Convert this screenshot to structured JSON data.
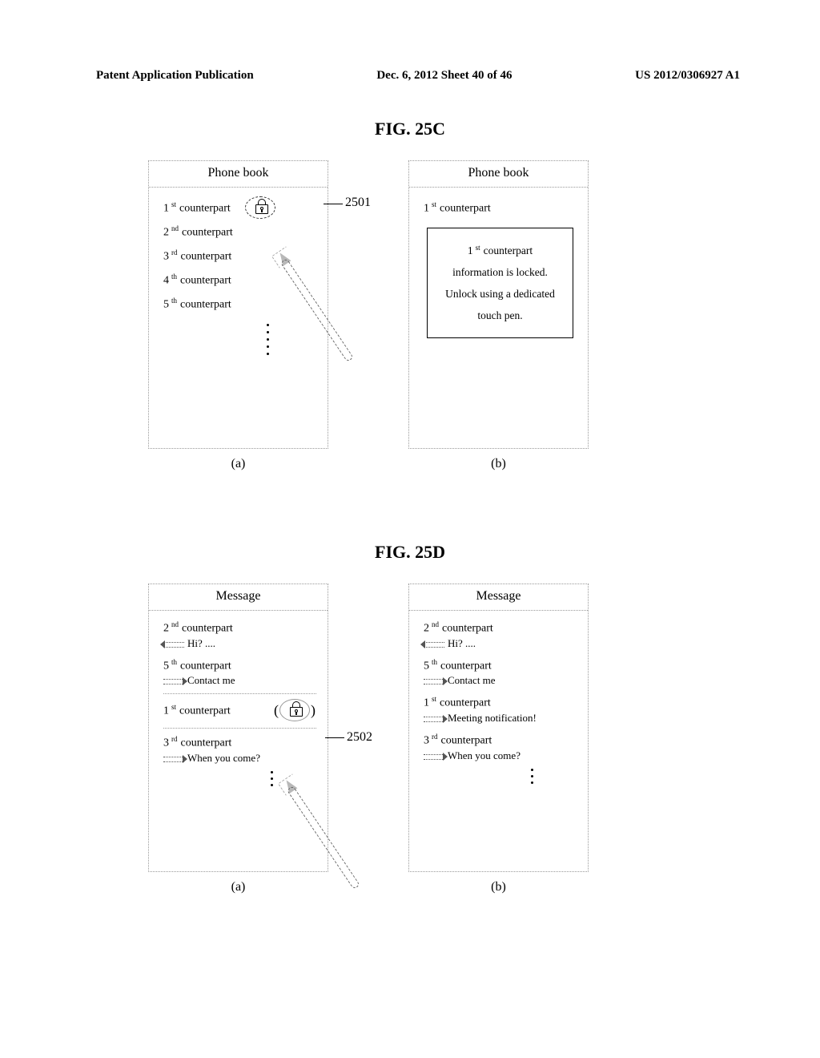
{
  "header": {
    "left": "Patent Application Publication",
    "center": "Dec. 6, 2012  Sheet 40 of 46",
    "right": "US 2012/0306927 A1"
  },
  "figC": {
    "title": "FIG. 25C",
    "ref": "2501",
    "a": {
      "caption": "(a)",
      "header": "Phone book",
      "contacts": [
        {
          "ord": "1",
          "suffix": "st",
          "label": "counterpart",
          "locked": true
        },
        {
          "ord": "2",
          "suffix": "nd",
          "label": "counterpart"
        },
        {
          "ord": "3",
          "suffix": "rd",
          "label": "counterpart"
        },
        {
          "ord": "4",
          "suffix": "th",
          "label": "counterpart"
        },
        {
          "ord": "5",
          "suffix": "th",
          "label": "counterpart"
        }
      ]
    },
    "b": {
      "caption": "(b)",
      "header": "Phone book",
      "selected": {
        "ord": "1",
        "suffix": "st",
        "label": "counterpart"
      },
      "info_line1_ord": "1",
      "info_line1_suffix": "st",
      "info_line1_rest": "counterpart",
      "info_line2": "information is locked.",
      "info_line3": "Unlock using a dedicated",
      "info_line4": "touch pen."
    }
  },
  "figD": {
    "title": "FIG. 25D",
    "ref": "2502",
    "a": {
      "caption": "(a)",
      "header": "Message",
      "msgs": [
        {
          "ord": "2",
          "suffix": "nd",
          "label": "counterpart",
          "dir": "in",
          "preview": "Hi? ....",
          "boxed": false
        },
        {
          "ord": "5",
          "suffix": "th",
          "label": "counterpart",
          "dir": "out",
          "preview": "Contact me",
          "boxed": false
        },
        {
          "ord": "1",
          "suffix": "st",
          "label": "counterpart",
          "dir": null,
          "preview": "",
          "boxed": true,
          "locked": true
        },
        {
          "ord": "3",
          "suffix": "rd",
          "label": "counterpart",
          "dir": "out",
          "preview": "When you come?",
          "boxed": false
        }
      ]
    },
    "b": {
      "caption": "(b)",
      "header": "Message",
      "msgs": [
        {
          "ord": "2",
          "suffix": "nd",
          "label": "counterpart",
          "dir": "in",
          "preview": "Hi? ....",
          "boxed": false
        },
        {
          "ord": "5",
          "suffix": "th",
          "label": "counterpart",
          "dir": "out",
          "preview": "Contact me",
          "boxed": false
        },
        {
          "ord": "1",
          "suffix": "st",
          "label": "counterpart",
          "dir": "out",
          "preview": "Meeting notification!",
          "boxed": false
        },
        {
          "ord": "3",
          "suffix": "rd",
          "label": "counterpart",
          "dir": "out",
          "preview": "When you come?",
          "boxed": false
        }
      ]
    }
  }
}
